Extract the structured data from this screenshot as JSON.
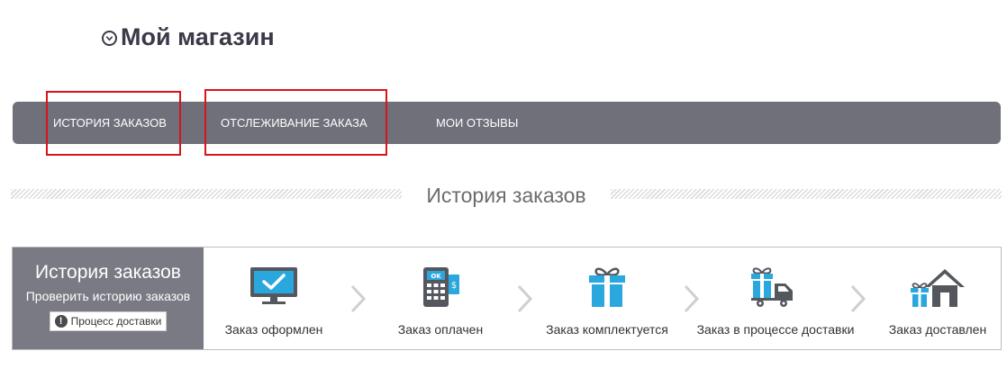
{
  "header": {
    "title": "Мой магазин"
  },
  "nav": {
    "items": [
      {
        "label": "История заказов"
      },
      {
        "label": "Отслеживание заказа"
      },
      {
        "label": "Мои отзывы"
      }
    ]
  },
  "section": {
    "title": "История заказов"
  },
  "status": {
    "side_title": "История заказов",
    "side_subtitle": "Проверить историю заказов",
    "side_button": "Процесс доставки",
    "steps": [
      {
        "label": "Заказ оформлен",
        "icon": "monitor-check-icon"
      },
      {
        "label": "Заказ оплачен",
        "icon": "payment-terminal-icon"
      },
      {
        "label": "Заказ комплектуется",
        "icon": "gift-box-icon"
      },
      {
        "label": "Заказ в процессе доставки",
        "icon": "delivery-truck-icon"
      },
      {
        "label": "Заказ доставлен",
        "icon": "house-gift-icon"
      }
    ]
  },
  "colors": {
    "nav_bg": "#6f7079",
    "highlight": "#d9141b",
    "icon_blue": "#2aa7dc",
    "icon_dark": "#55575f"
  }
}
